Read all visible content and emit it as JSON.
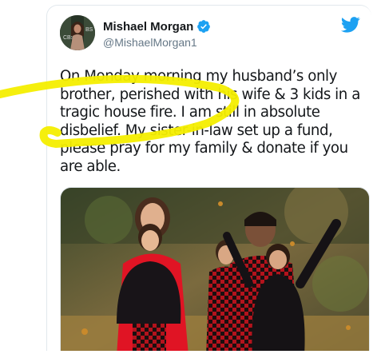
{
  "tweet": {
    "author_name": "Mishael Morgan",
    "handle": "@MishaelMorgan1",
    "verified": true,
    "text": "On Monday morning my husband’s only brother, perished with his wife & 3 kids in a tragic house fire. I am still in absolute disbelief. My sister-in-law set up a fund, please pray for my family & donate if you are able.",
    "highlight_color": "#f4ee00",
    "brand_color": "#1da1f2"
  },
  "icons": {
    "verified": "verified-badge-icon",
    "logo": "twitter-bird-icon"
  }
}
